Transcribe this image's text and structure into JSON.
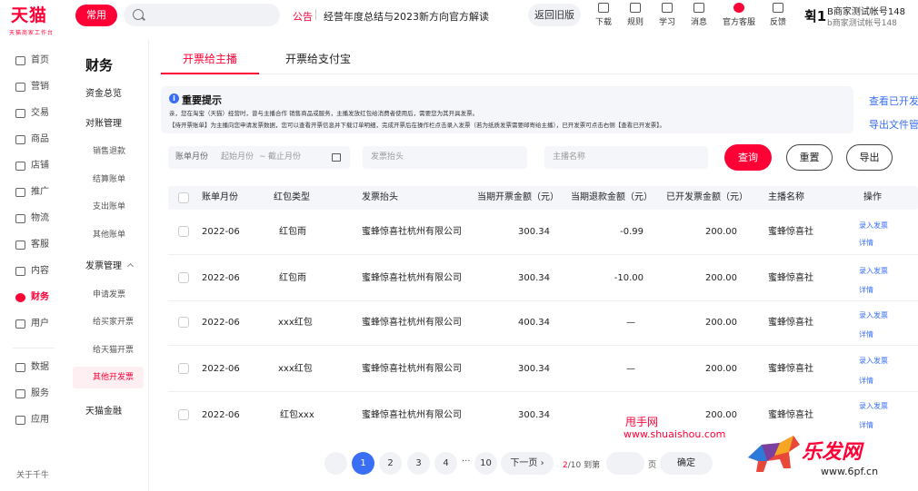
{
  "header": {
    "logo": "天猫",
    "logo_sub": "天猫商家工作台",
    "common_tag": "常用",
    "search_placeholder": "",
    "notice_label": "公告",
    "notice_text": "经营年度总结与2023新方向官方解读",
    "back_old": "返回旧版",
    "tools": [
      {
        "label": "下载",
        "icon": "download-icon"
      },
      {
        "label": "规则",
        "icon": "rules-icon"
      },
      {
        "label": "学习",
        "icon": "learn-icon"
      },
      {
        "label": "消息",
        "icon": "message-icon"
      },
      {
        "label": "官方客服",
        "icon": "service-icon"
      },
      {
        "label": "反馈",
        "icon": "feedback-icon"
      }
    ],
    "account_initial": "휙1",
    "account_name": "B商家测试帐号148",
    "account_sub": "b商家测试帐号148"
  },
  "nav_primary": {
    "items": [
      {
        "label": "首页",
        "icon": "home-icon"
      },
      {
        "label": "营销",
        "icon": "marketing-icon"
      },
      {
        "label": "交易",
        "icon": "trade-icon"
      },
      {
        "label": "商品",
        "icon": "goods-icon"
      },
      {
        "label": "店铺",
        "icon": "shop-icon"
      },
      {
        "label": "推广",
        "icon": "promote-icon"
      },
      {
        "label": "物流",
        "icon": "logistics-icon"
      },
      {
        "label": "客服",
        "icon": "cs-icon"
      },
      {
        "label": "内容",
        "icon": "content-icon"
      },
      {
        "label": "财务",
        "icon": "finance-icon"
      },
      {
        "label": "用户",
        "icon": "user-icon"
      },
      {
        "label": "数据",
        "icon": "data-icon"
      },
      {
        "label": "服务",
        "icon": "service-grid-icon"
      },
      {
        "label": "应用",
        "icon": "app-icon"
      }
    ],
    "about": "关于千牛"
  },
  "nav_secondary": {
    "title": "财务",
    "items": [
      {
        "label": "资金总览",
        "sub": false
      },
      {
        "label": "对账管理",
        "sub": false
      },
      {
        "label": "销售退款",
        "sub": true
      },
      {
        "label": "结算账单",
        "sub": true
      },
      {
        "label": "支出账单",
        "sub": true
      },
      {
        "label": "其他账单",
        "sub": true
      },
      {
        "label": "发票管理",
        "sub": false
      },
      {
        "label": "申请发票",
        "sub": true
      },
      {
        "label": "给买家开票",
        "sub": true
      },
      {
        "label": "给天猫开票",
        "sub": true
      },
      {
        "label": "其他开发票",
        "sub": true
      },
      {
        "label": "天猫金融",
        "sub": false
      }
    ]
  },
  "tabs": [
    "开票给主播",
    "开票给支付宝"
  ],
  "tips": {
    "icon": "i",
    "title": "重要提示",
    "line1": "亲，您在淘宝（天猫）经营时，曾与主播合作 销售商品或服务，主播发放红包给消费者使用后，需要您为其开具发票。",
    "line2": "【待开票账单】为主播向您申请发票数据，您可以查看开票信息并下载订单明细，完成开票后在操作栏点击录入发票（若为纸质发票需要邮寄给主播），已开发票可点击右侧【查看已开发票】。"
  },
  "side_links": {
    "view_issued": "查看已开发",
    "export_files": "导出文件管"
  },
  "filters": {
    "month_label": "账单月份",
    "month_start": "起始月份",
    "month_sep": "~",
    "month_end": "截止月份",
    "invoice_title_placeholder": "发票抬头",
    "anchor_placeholder": "主播名称",
    "query": "查询",
    "reset": "重置",
    "export": "导出"
  },
  "table": {
    "columns": [
      "账单月份",
      "红包类型",
      "发票抬头",
      "当期开票金额（元）",
      "当期退款金额（元）",
      "已开发票金额（元）",
      "主播名称",
      "操作"
    ],
    "rows": [
      {
        "month": "2022-06",
        "type": "红包雨",
        "title": "蜜蜂惊喜社杭州有限公司",
        "invoice": "300.34",
        "refund": "-0.99",
        "issued": "200.00",
        "anchor": "蜜蜂惊喜社"
      },
      {
        "month": "2022-06",
        "type": "红包雨",
        "title": "蜜蜂惊喜社杭州有限公司",
        "invoice": "300.34",
        "refund": "-10.00",
        "issued": "200.00",
        "anchor": "蜜蜂惊喜社"
      },
      {
        "month": "2022-06",
        "type": "xxx红包",
        "title": "蜜蜂惊喜社杭州有限公司",
        "invoice": "400.34",
        "refund": "—",
        "issued": "200.00",
        "anchor": "蜜蜂惊喜社"
      },
      {
        "month": "2022-06",
        "type": "xxx红包",
        "title": "蜜蜂惊喜社杭州有限公司",
        "invoice": "300.34",
        "refund": "—",
        "issued": "200.00",
        "anchor": "蜜蜂惊喜社"
      },
      {
        "month": "2022-06",
        "type": "红包xxx",
        "title": "蜜蜂惊喜社杭州有限公司",
        "invoice": "300.34",
        "refund": "",
        "issued": "200.00",
        "anchor": "蜜蜂惊喜社"
      }
    ],
    "action_enter": "录入发票",
    "action_detail": "详情"
  },
  "pagination": {
    "pages": [
      "1",
      "2",
      "3",
      "4"
    ],
    "dots": "···",
    "last": "10",
    "next": "下一页",
    "current": "2",
    "total": "/10",
    "goto": "到第",
    "page_unit": "页",
    "confirm": "确定"
  },
  "watermarks": {
    "w1": "甩手网",
    "w2": "www.shuaishou.com",
    "w3": "乐发网",
    "w4": "www.6pf.cn"
  },
  "colors": {
    "brand": "#ff0036",
    "link": "#3a6ff5"
  }
}
